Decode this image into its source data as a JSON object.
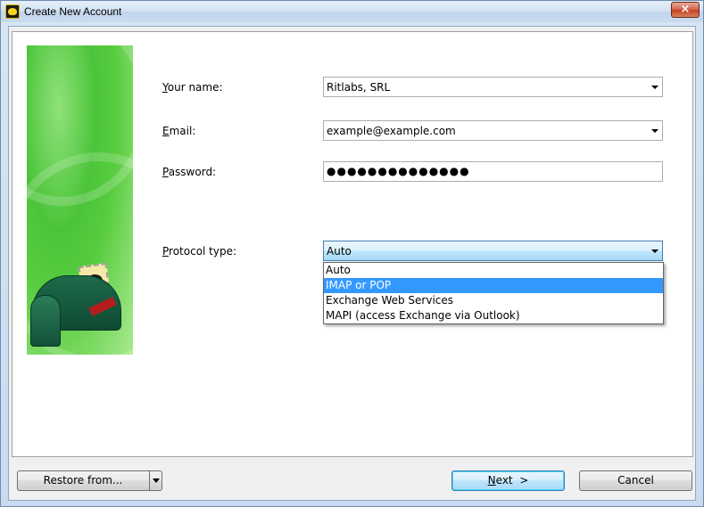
{
  "window": {
    "title": "Create New Account",
    "close_glyph": "×"
  },
  "form": {
    "name_label_key": "Y",
    "name_label_rest": "our name:",
    "name_value": "Ritlabs, SRL",
    "email_label_key": "E",
    "email_label_rest": "mail:",
    "email_value": "example@example.com",
    "password_label_key": "P",
    "password_label_rest": "assword:",
    "password_value": "●●●●●●●●●●●●●●",
    "protocol_label_key": "P",
    "protocol_label_rest": "rotocol type:",
    "protocol_value": "Auto",
    "protocol_options": [
      "Auto",
      "IMAP or POP",
      "Exchange Web Services",
      "MAPI (access Exchange via Outlook)"
    ],
    "protocol_highlighted": "IMAP or POP"
  },
  "buttons": {
    "restore_label": "Restore from...",
    "next_key": "N",
    "next_rest": "ext  >",
    "cancel_label": "Cancel"
  },
  "icons": {
    "app": "bat-logo-icon",
    "banner": "mailbox-illustration"
  },
  "colors": {
    "banner_green": "#4cc43a",
    "selection_blue": "#3399ff",
    "close_red": "#c5401f"
  }
}
